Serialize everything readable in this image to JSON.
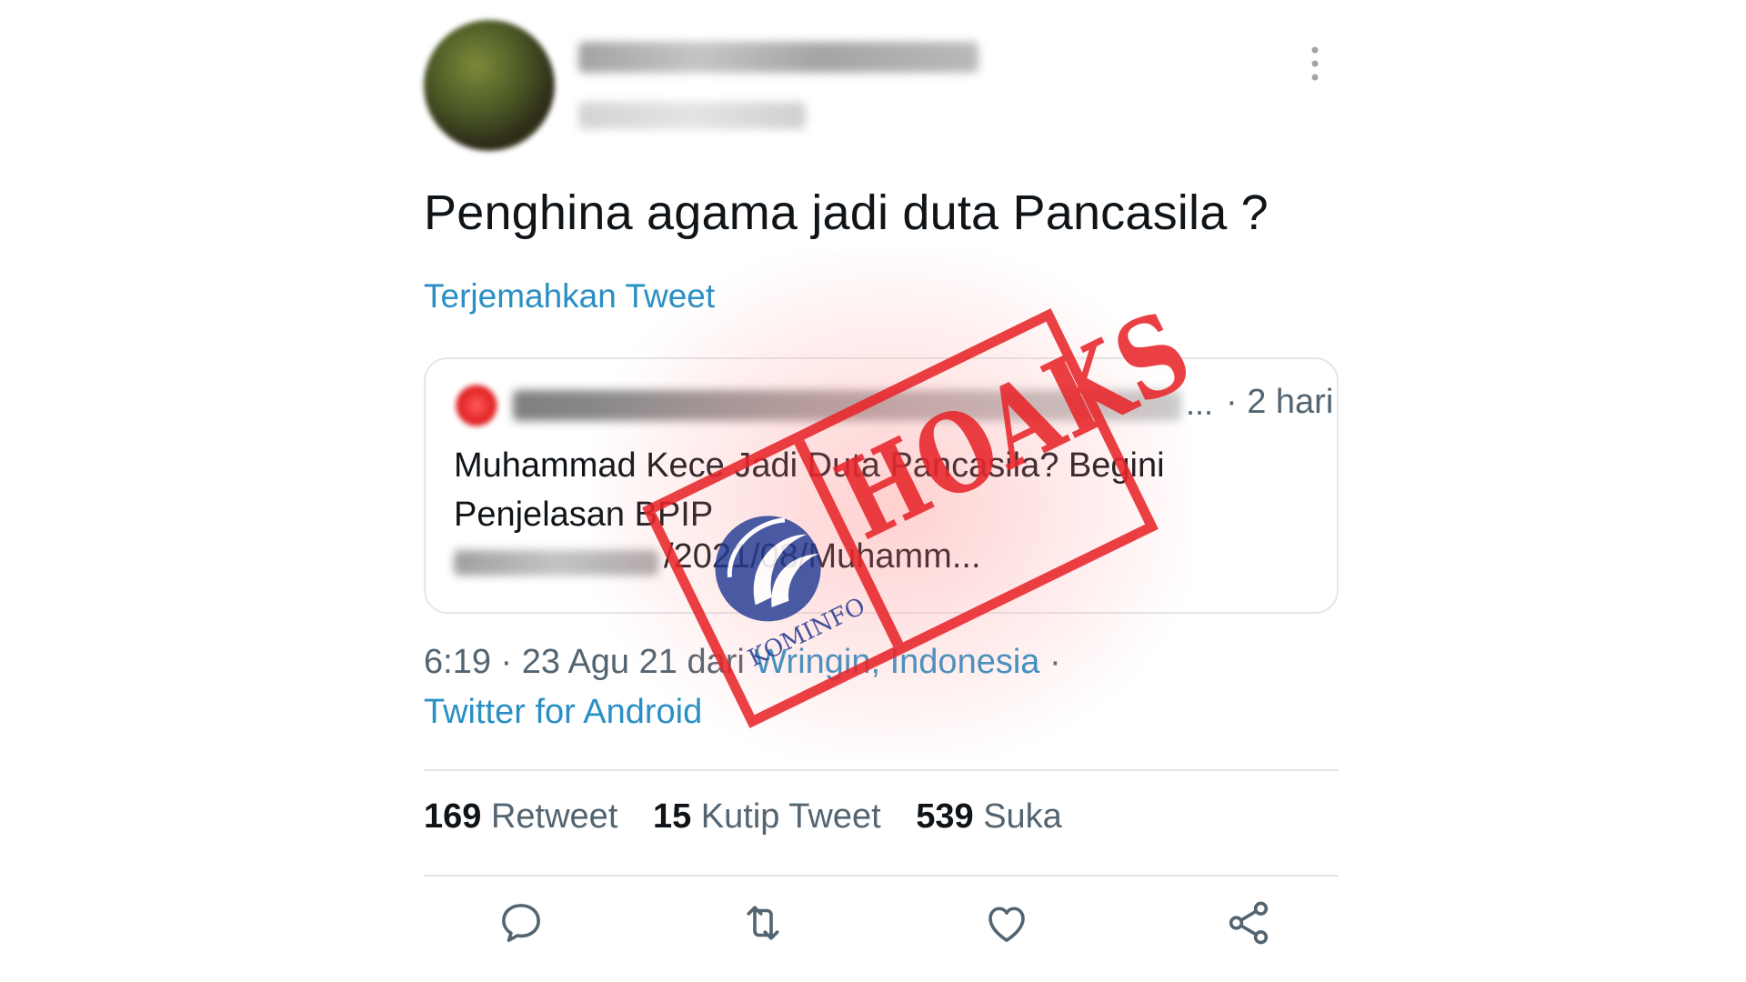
{
  "tweet": {
    "text": "Penghina agama jadi duta Pancasila ?",
    "translate_label": "Terjemahkan Tweet",
    "quoted": {
      "ellipsis": "...",
      "time": "· 2 hari",
      "text": "Muhammad Kece Jadi Duta Pancasila? Begini Penjelasan BPIP",
      "link_tail": "/2021/08/Muhamm..."
    },
    "meta": {
      "time_date": "6:19 · 23 Agu 21 dari ",
      "location": "Wringin, Indonesia",
      "sep": " ·",
      "source": "Twitter for Android"
    },
    "stats": [
      {
        "count": "169",
        "label": "Retweet"
      },
      {
        "count": "15",
        "label": "Kutip Tweet"
      },
      {
        "count": "539",
        "label": "Suka"
      }
    ],
    "actions": [
      "reply-icon",
      "retweet-icon",
      "like-icon",
      "share-icon"
    ]
  },
  "stamp": {
    "text": "HOAKS",
    "logo_text": "KOMINFO",
    "color": "#e8262b"
  },
  "colors": {
    "link": "#2a8fc4",
    "secondary": "#536471",
    "primary_text": "#0f1419"
  }
}
